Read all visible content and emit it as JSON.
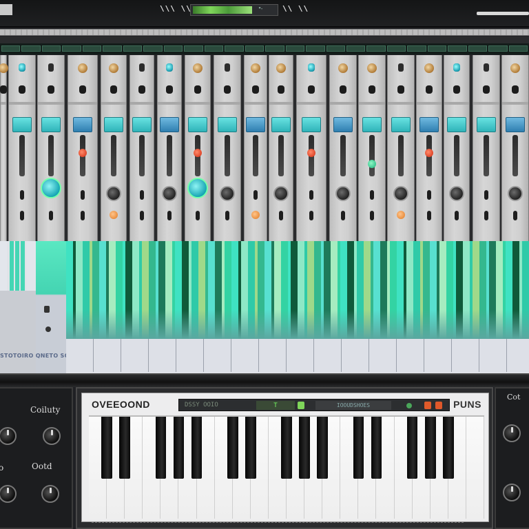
{
  "topbar": {
    "ticks_left": "\\\\\\ \\\\\\",
    "ticks_right": "\\\\ \\\\",
    "lcd_value": "ᐩᐧ"
  },
  "rollarea": {
    "brand_text": "STOTOIRO QNETO SOINTS."
  },
  "synth": {
    "title": "OVEEOOND",
    "display_left": "DSSY  OOIO",
    "display_lcd": "T",
    "display_center": "IOOUDSHOES",
    "brand_right": "PUNS"
  },
  "left_panel": {
    "label_top": "Coiluty",
    "label_mid": "Ootd",
    "label_left": "o"
  },
  "right_panel": {
    "label_top": "Cot"
  },
  "colors": {
    "accent_teal": "#3cdcc0",
    "fader_blue": "#3f8fc0",
    "led_red": "#d02a10"
  },
  "icons": [
    "fader-cap-icon",
    "rotary-knob-icon",
    "led-indicator-icon",
    "jack-icon"
  ]
}
